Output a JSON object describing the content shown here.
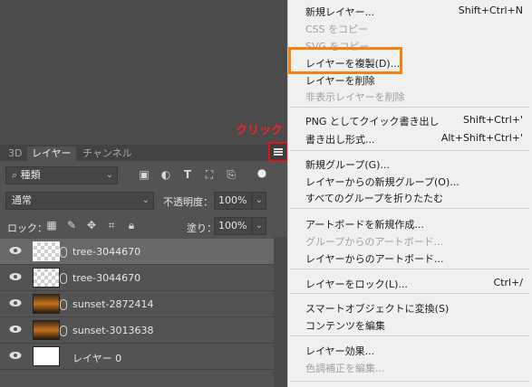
{
  "panel": {
    "tabs": [
      "3D",
      "レイヤー",
      "チャンネル"
    ],
    "callout": "クリック",
    "filter_kind": "種類",
    "blend_mode": "通常",
    "opacity_label": "不透明度：",
    "opacity_value": "100%",
    "lock_label": "ロック：",
    "fill_label": "塗り：",
    "fill_value": "100%",
    "layers": [
      {
        "name": "tree-3044670",
        "selected": true,
        "thumb": "transparent"
      },
      {
        "name": "tree-3044670",
        "selected": false,
        "thumb": "transparent"
      },
      {
        "name": "sunset-2872414",
        "selected": false,
        "thumb": "sunset"
      },
      {
        "name": "sunset-3013638",
        "selected": false,
        "thumb": "sunset"
      },
      {
        "name": "レイヤー 0",
        "selected": false,
        "thumb": "white"
      }
    ]
  },
  "menu": {
    "items": [
      {
        "label": "新規レイヤー...",
        "shortcut": "Shift+Ctrl+N",
        "disabled": false
      },
      {
        "label": "CSS をコピー",
        "shortcut": "",
        "disabled": true
      },
      {
        "label": "SVG をコピー",
        "shortcut": "",
        "disabled": true
      },
      {
        "label": "レイヤーを複製(D)...",
        "shortcut": "",
        "disabled": false
      },
      {
        "label": "レイヤーを削除",
        "shortcut": "",
        "disabled": false
      },
      {
        "label": "非表示レイヤーを削除",
        "shortcut": "",
        "disabled": true
      },
      {
        "label": "PNG としてクイック書き出し",
        "shortcut": "Shift+Ctrl+'",
        "disabled": false
      },
      {
        "label": "書き出し形式...",
        "shortcut": "Alt+Shift+Ctrl+'",
        "disabled": false
      },
      {
        "label": "新規グループ(G)...",
        "shortcut": "",
        "disabled": false
      },
      {
        "label": "レイヤーからの新規グループ(O)...",
        "shortcut": "",
        "disabled": false
      },
      {
        "label": "すべてのグループを折りたたむ",
        "shortcut": "",
        "disabled": false
      },
      {
        "label": "アートボードを新規作成...",
        "shortcut": "",
        "disabled": false
      },
      {
        "label": "グループからのアートボード...",
        "shortcut": "",
        "disabled": true
      },
      {
        "label": "レイヤーからのアートボード...",
        "shortcut": "",
        "disabled": false
      },
      {
        "label": "レイヤーをロック(L)...",
        "shortcut": "Ctrl+/",
        "disabled": false
      },
      {
        "label": "スマートオブジェクトに変換(S)",
        "shortcut": "",
        "disabled": false
      },
      {
        "label": "コンテンツを編集",
        "shortcut": "",
        "disabled": false
      },
      {
        "label": "レイヤー効果...",
        "shortcut": "",
        "disabled": false
      },
      {
        "label": "色調補正を編集...",
        "shortcut": "",
        "disabled": true
      }
    ]
  },
  "colors": {
    "highlight": "#f5820a",
    "callout": "#ff2020"
  }
}
